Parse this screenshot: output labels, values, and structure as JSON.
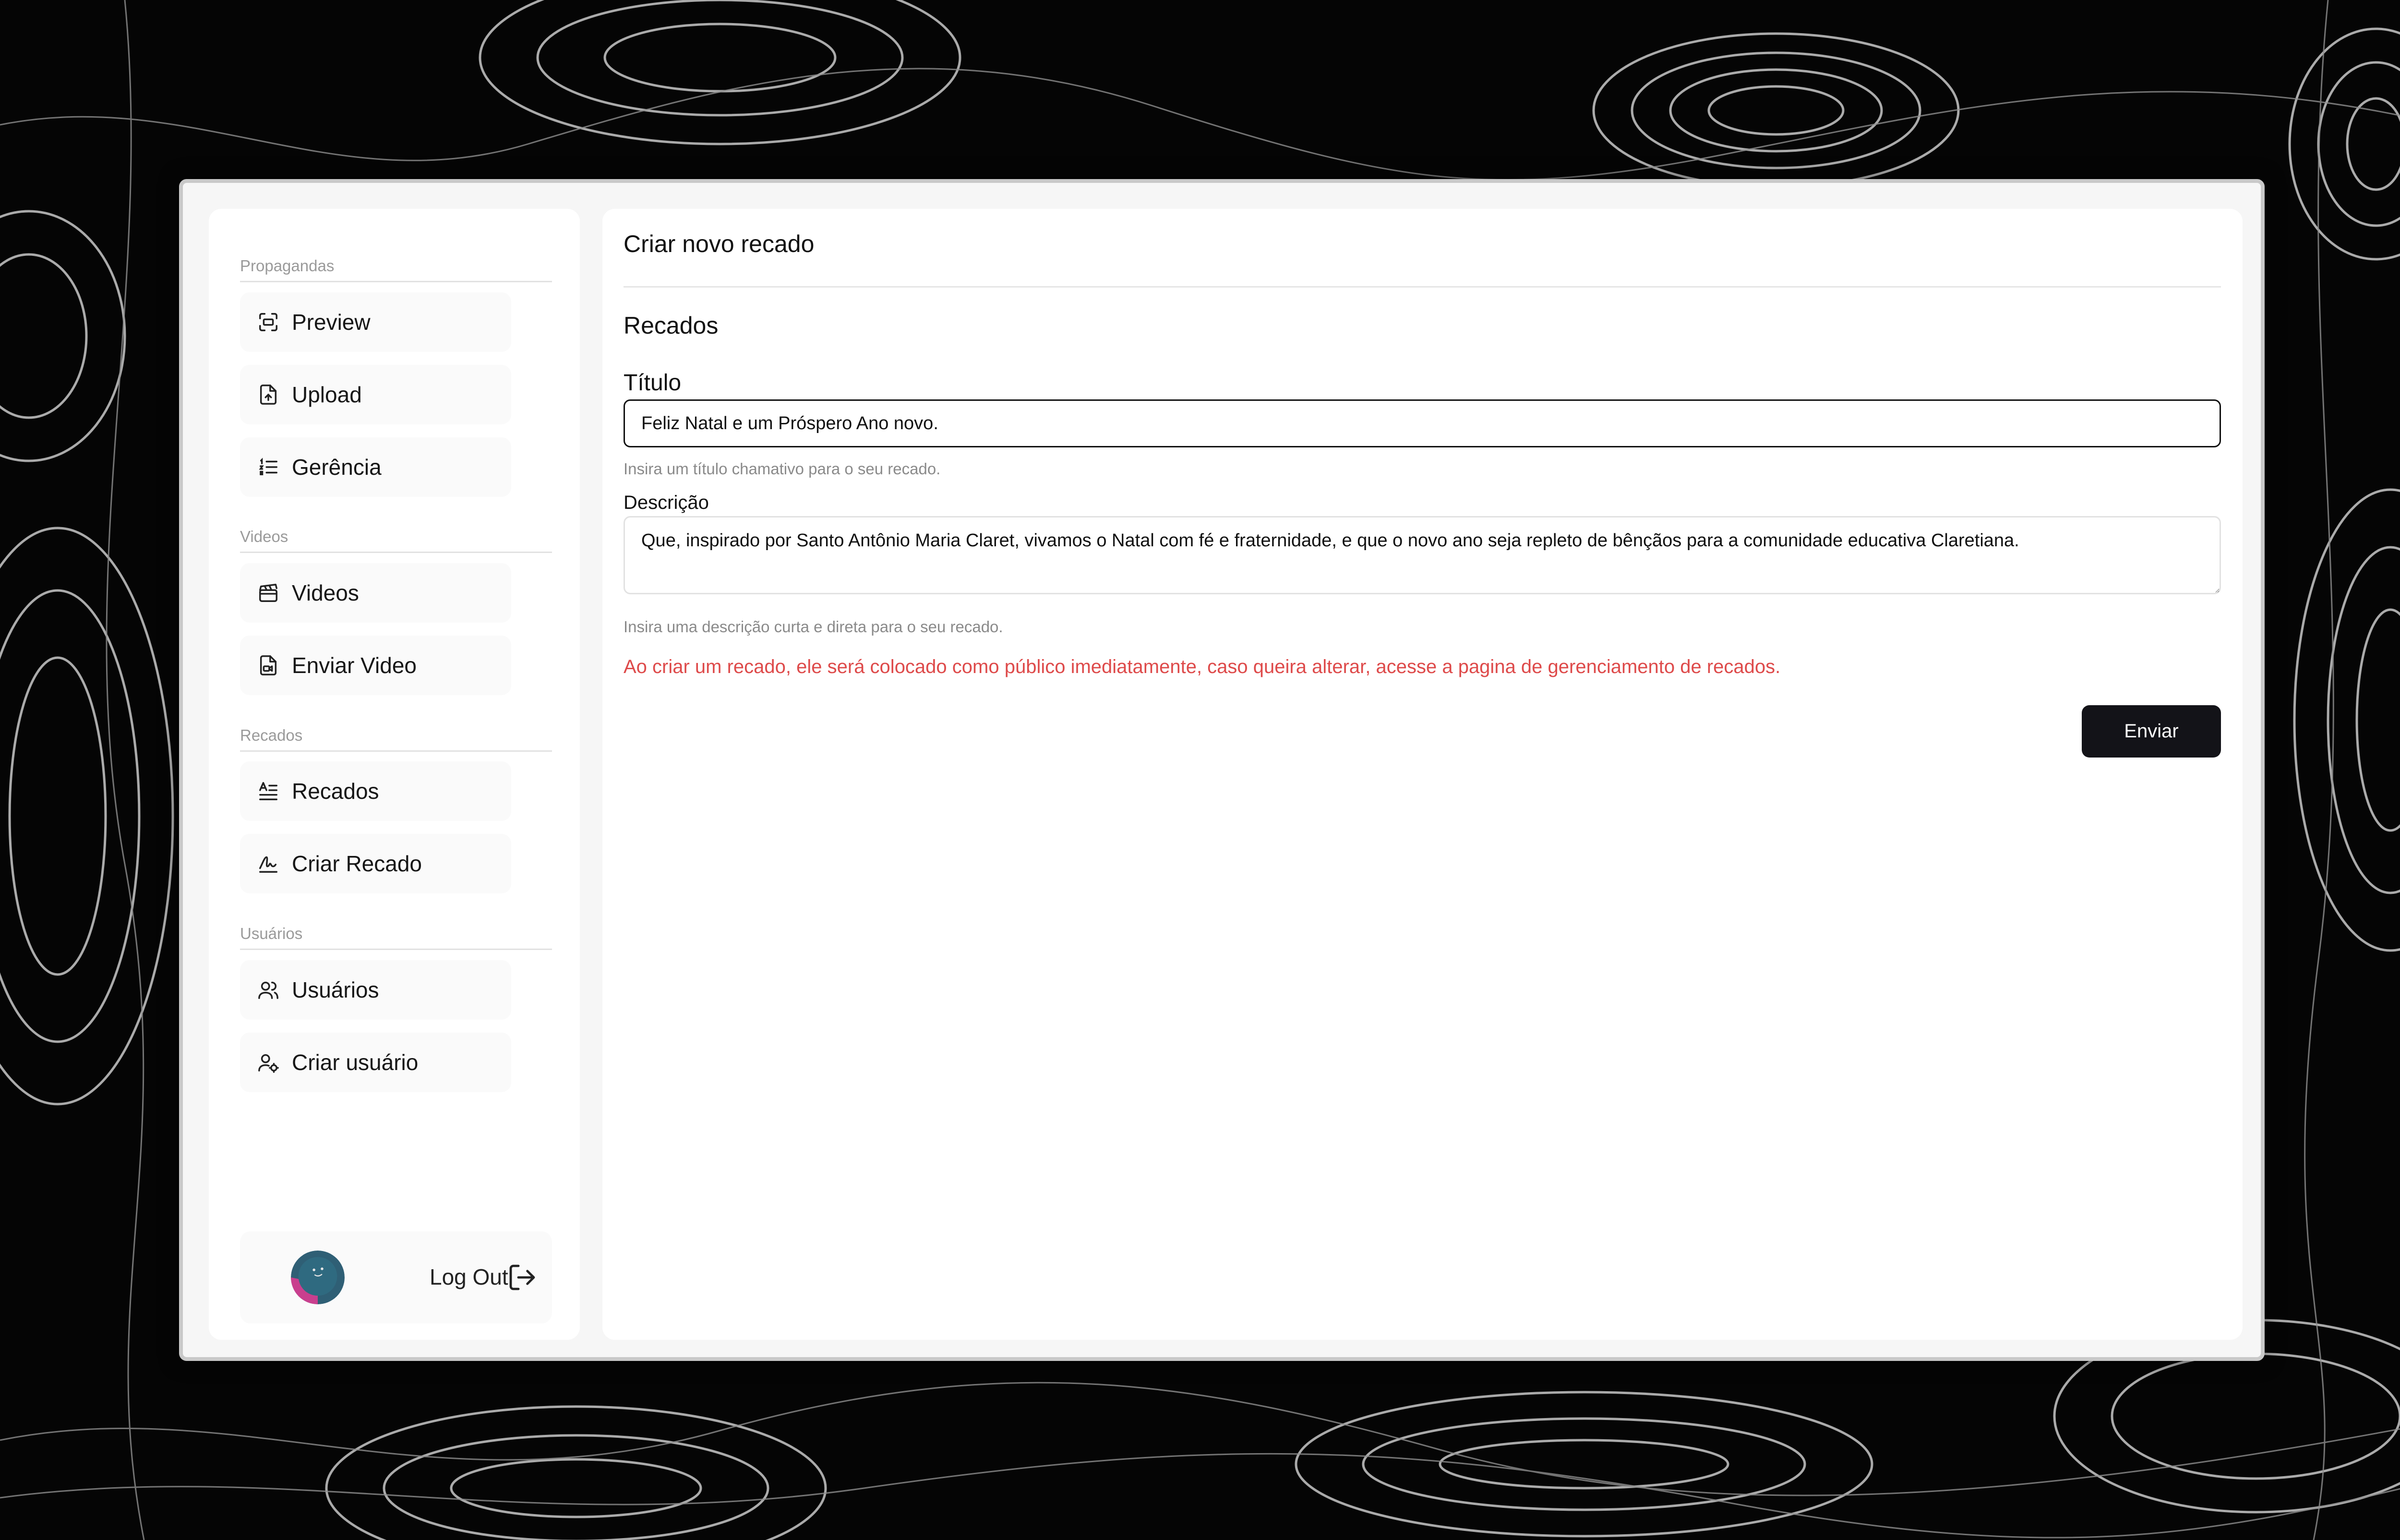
{
  "sidebar": {
    "sections": [
      {
        "title": "Propagandas",
        "items": [
          {
            "label": "Preview",
            "icon": "preview-icon"
          },
          {
            "label": "Upload",
            "icon": "file-upload-icon"
          },
          {
            "label": "Gerência",
            "icon": "list-icon"
          }
        ]
      },
      {
        "title": "Videos",
        "items": [
          {
            "label": "Videos",
            "icon": "clapperboard-icon"
          },
          {
            "label": "Enviar Video",
            "icon": "file-video-icon"
          }
        ]
      },
      {
        "title": "Recados",
        "items": [
          {
            "label": "Recados",
            "icon": "text-lines-icon"
          },
          {
            "label": "Criar Recado",
            "icon": "signature-icon"
          }
        ]
      },
      {
        "title": "Usuários",
        "items": [
          {
            "label": "Usuários",
            "icon": "users-icon"
          },
          {
            "label": "Criar usuário",
            "icon": "user-cog-icon"
          }
        ]
      }
    ],
    "footer": {
      "logout_label": "Log Out",
      "avatar_icon": "avatar",
      "logout_icon": "logout-icon"
    }
  },
  "main": {
    "page_title": "Criar novo recado",
    "section_title": "Recados",
    "form": {
      "title_label": "Título",
      "title_value": "Feliz Natal e um Próspero Ano novo.",
      "title_help": "Insira um título chamativo para o seu recado.",
      "description_label": "Descrição",
      "description_value": "Que, inspirado por Santo Antônio Maria Claret, vivamos o Natal com fé e fraternidade, e que o novo ano seja repleto de bênçãos para a comunidade educativa Claretiana.",
      "description_help": "Insira uma descrição curta e direta para o seu recado.",
      "warning": "Ao criar um recado, ele será colocado como público imediatamente, caso queira alterar, acesse a pagina de gerenciamento de recados.",
      "submit_label": "Enviar"
    }
  },
  "colors": {
    "warning": "#de4a4a",
    "button": "#131318",
    "panel": "#ffffff",
    "frame": "#f6f6f6"
  }
}
